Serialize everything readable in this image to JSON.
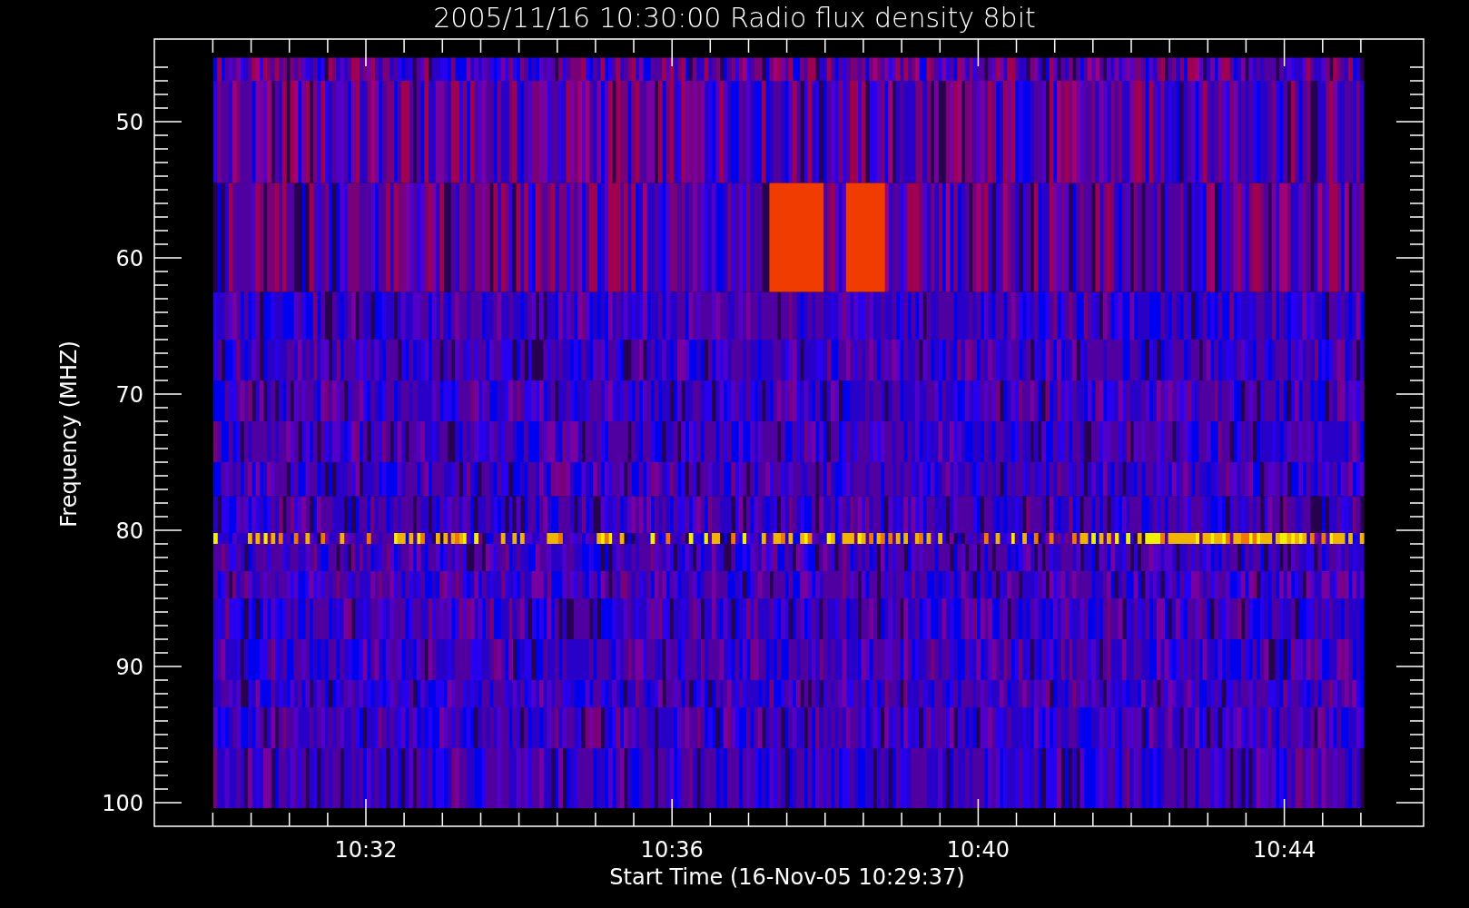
{
  "title": "2005/11/16 10:30:00 Radio flux density 8bit",
  "y_axis": {
    "label": "Frequency (MHZ)",
    "ticks": [
      "50",
      "60",
      "70",
      "80",
      "90",
      "100"
    ]
  },
  "x_axis": {
    "label": "Start Time (16-Nov-05 10:29:37)",
    "ticks": [
      "10:32",
      "10:36",
      "10:40",
      "10:44"
    ]
  }
}
